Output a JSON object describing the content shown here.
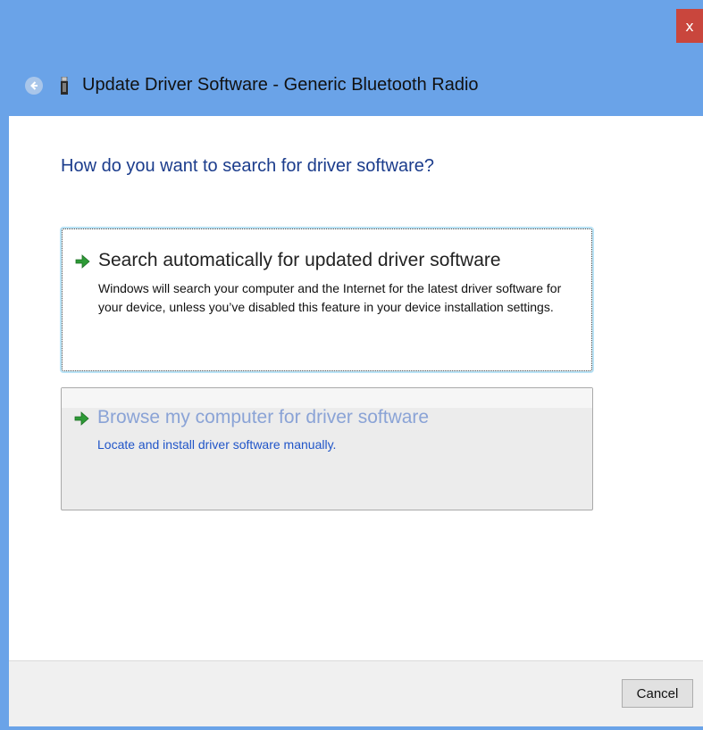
{
  "window": {
    "title": "Update Driver Software - Generic Bluetooth Radio",
    "close_label": "x",
    "accent_color": "#6aa3e8",
    "close_color": "#c9463d"
  },
  "main": {
    "question": "How do you want to search for driver software?",
    "options": [
      {
        "icon": "green-arrow-icon",
        "title": "Search automatically for updated driver software",
        "description": "Windows will search your computer and the Internet for the latest driver software for your device, unless you’ve disabled this feature in your device installation settings."
      },
      {
        "icon": "green-arrow-icon",
        "title": "Browse my computer for driver software",
        "description": "Locate and install driver software manually."
      }
    ]
  },
  "footer": {
    "cancel_label": "Cancel"
  }
}
